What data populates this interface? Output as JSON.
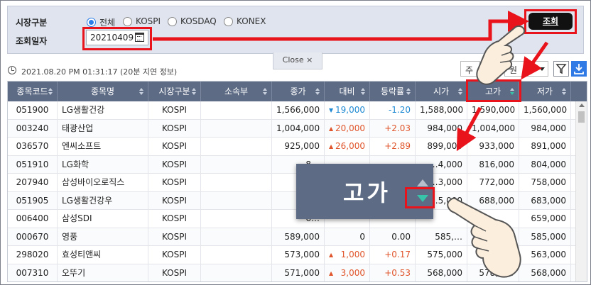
{
  "search": {
    "market_label": "시장구분",
    "date_label": "조회일자",
    "radio_options": [
      {
        "label": "전체",
        "selected": true
      },
      {
        "label": "KOSPI",
        "selected": false
      },
      {
        "label": "KOSDAQ",
        "selected": false
      },
      {
        "label": "KONEX",
        "selected": false
      }
    ],
    "date_value": "20210409",
    "query_button": "조회"
  },
  "info": {
    "timestamp": "2021.08.20 PM 01:31:17",
    "delay_note": "(20분 지연 정보)",
    "close_tab": "Close ×",
    "select1": "주",
    "select2": "원"
  },
  "table": {
    "columns": [
      "종목코드",
      "종목명",
      "시장구분",
      "소속부",
      "종가",
      "대비",
      "등락률",
      "시가",
      "고가",
      "저가"
    ],
    "rows": [
      {
        "code": "051900",
        "name": "LG생활건강",
        "market": "KOSPI",
        "division": "",
        "close": "1,566,000",
        "change": "19,000",
        "dir": "dn",
        "rate": "-1.20",
        "open": "1,588,000",
        "high": "1,590,000",
        "low": "1,560,000"
      },
      {
        "code": "003240",
        "name": "태광산업",
        "market": "KOSPI",
        "division": "",
        "close": "1,004,000",
        "change": "20,000",
        "dir": "up",
        "rate": "+2.03",
        "open": "984,000",
        "high": "1,004,000",
        "low": "984,000"
      },
      {
        "code": "036570",
        "name": "엔씨소프트",
        "market": "KOSPI",
        "division": "",
        "close": "925,000",
        "change": "26,000",
        "dir": "up",
        "rate": "+2.89",
        "open": "899,000",
        "high": "933,000",
        "low": "891,000"
      },
      {
        "code": "051910",
        "name": "LG화학",
        "market": "KOSPI",
        "division": "",
        "close": "8…",
        "change": "",
        "dir": "none",
        "rate": "",
        "open": "…4,000",
        "high": "816,000",
        "low": "804,000"
      },
      {
        "code": "207940",
        "name": "삼성바이오로직스",
        "market": "KOSPI",
        "division": "",
        "close": "7…",
        "change": "",
        "dir": "none",
        "rate": "",
        "open": "…3,000",
        "high": "772,000",
        "low": "758,000"
      },
      {
        "code": "051905",
        "name": "LG생활건강우",
        "market": "KOSPI",
        "division": "",
        "close": "6…",
        "change": "",
        "dir": "none",
        "rate": "",
        "open": "…5,000",
        "high": "688,000",
        "low": "683,000"
      },
      {
        "code": "006400",
        "name": "삼성SDI",
        "market": "KOSPI",
        "division": "",
        "close": "6…",
        "change": "",
        "dir": "none",
        "rate": "",
        "open": "",
        "high": "",
        "low": "659,000"
      },
      {
        "code": "000670",
        "name": "영풍",
        "market": "KOSPI",
        "division": "",
        "close": "589,000",
        "change": "0",
        "dir": "none",
        "rate": "0.00",
        "open": "585,…",
        "high": "",
        "low": "585,000"
      },
      {
        "code": "298020",
        "name": "효성티앤씨",
        "market": "KOSPI",
        "division": "",
        "close": "573,000",
        "change": "1,000",
        "dir": "up",
        "rate": "+0.17",
        "open": "575,000",
        "high": "",
        "low": "563,000"
      },
      {
        "code": "007310",
        "name": "오뚜기",
        "market": "KOSPI",
        "division": "",
        "close": "571,000",
        "change": "3,000",
        "dir": "up",
        "rate": "+0.53",
        "open": "568,000",
        "high": "578,000",
        "low": "568,000"
      }
    ]
  },
  "zoom_callout": {
    "label": "고가"
  },
  "colors": {
    "accent_red": "#e8131b",
    "header_bg": "#5d6b85",
    "up": "#e0552b",
    "down": "#1f8ad3"
  }
}
